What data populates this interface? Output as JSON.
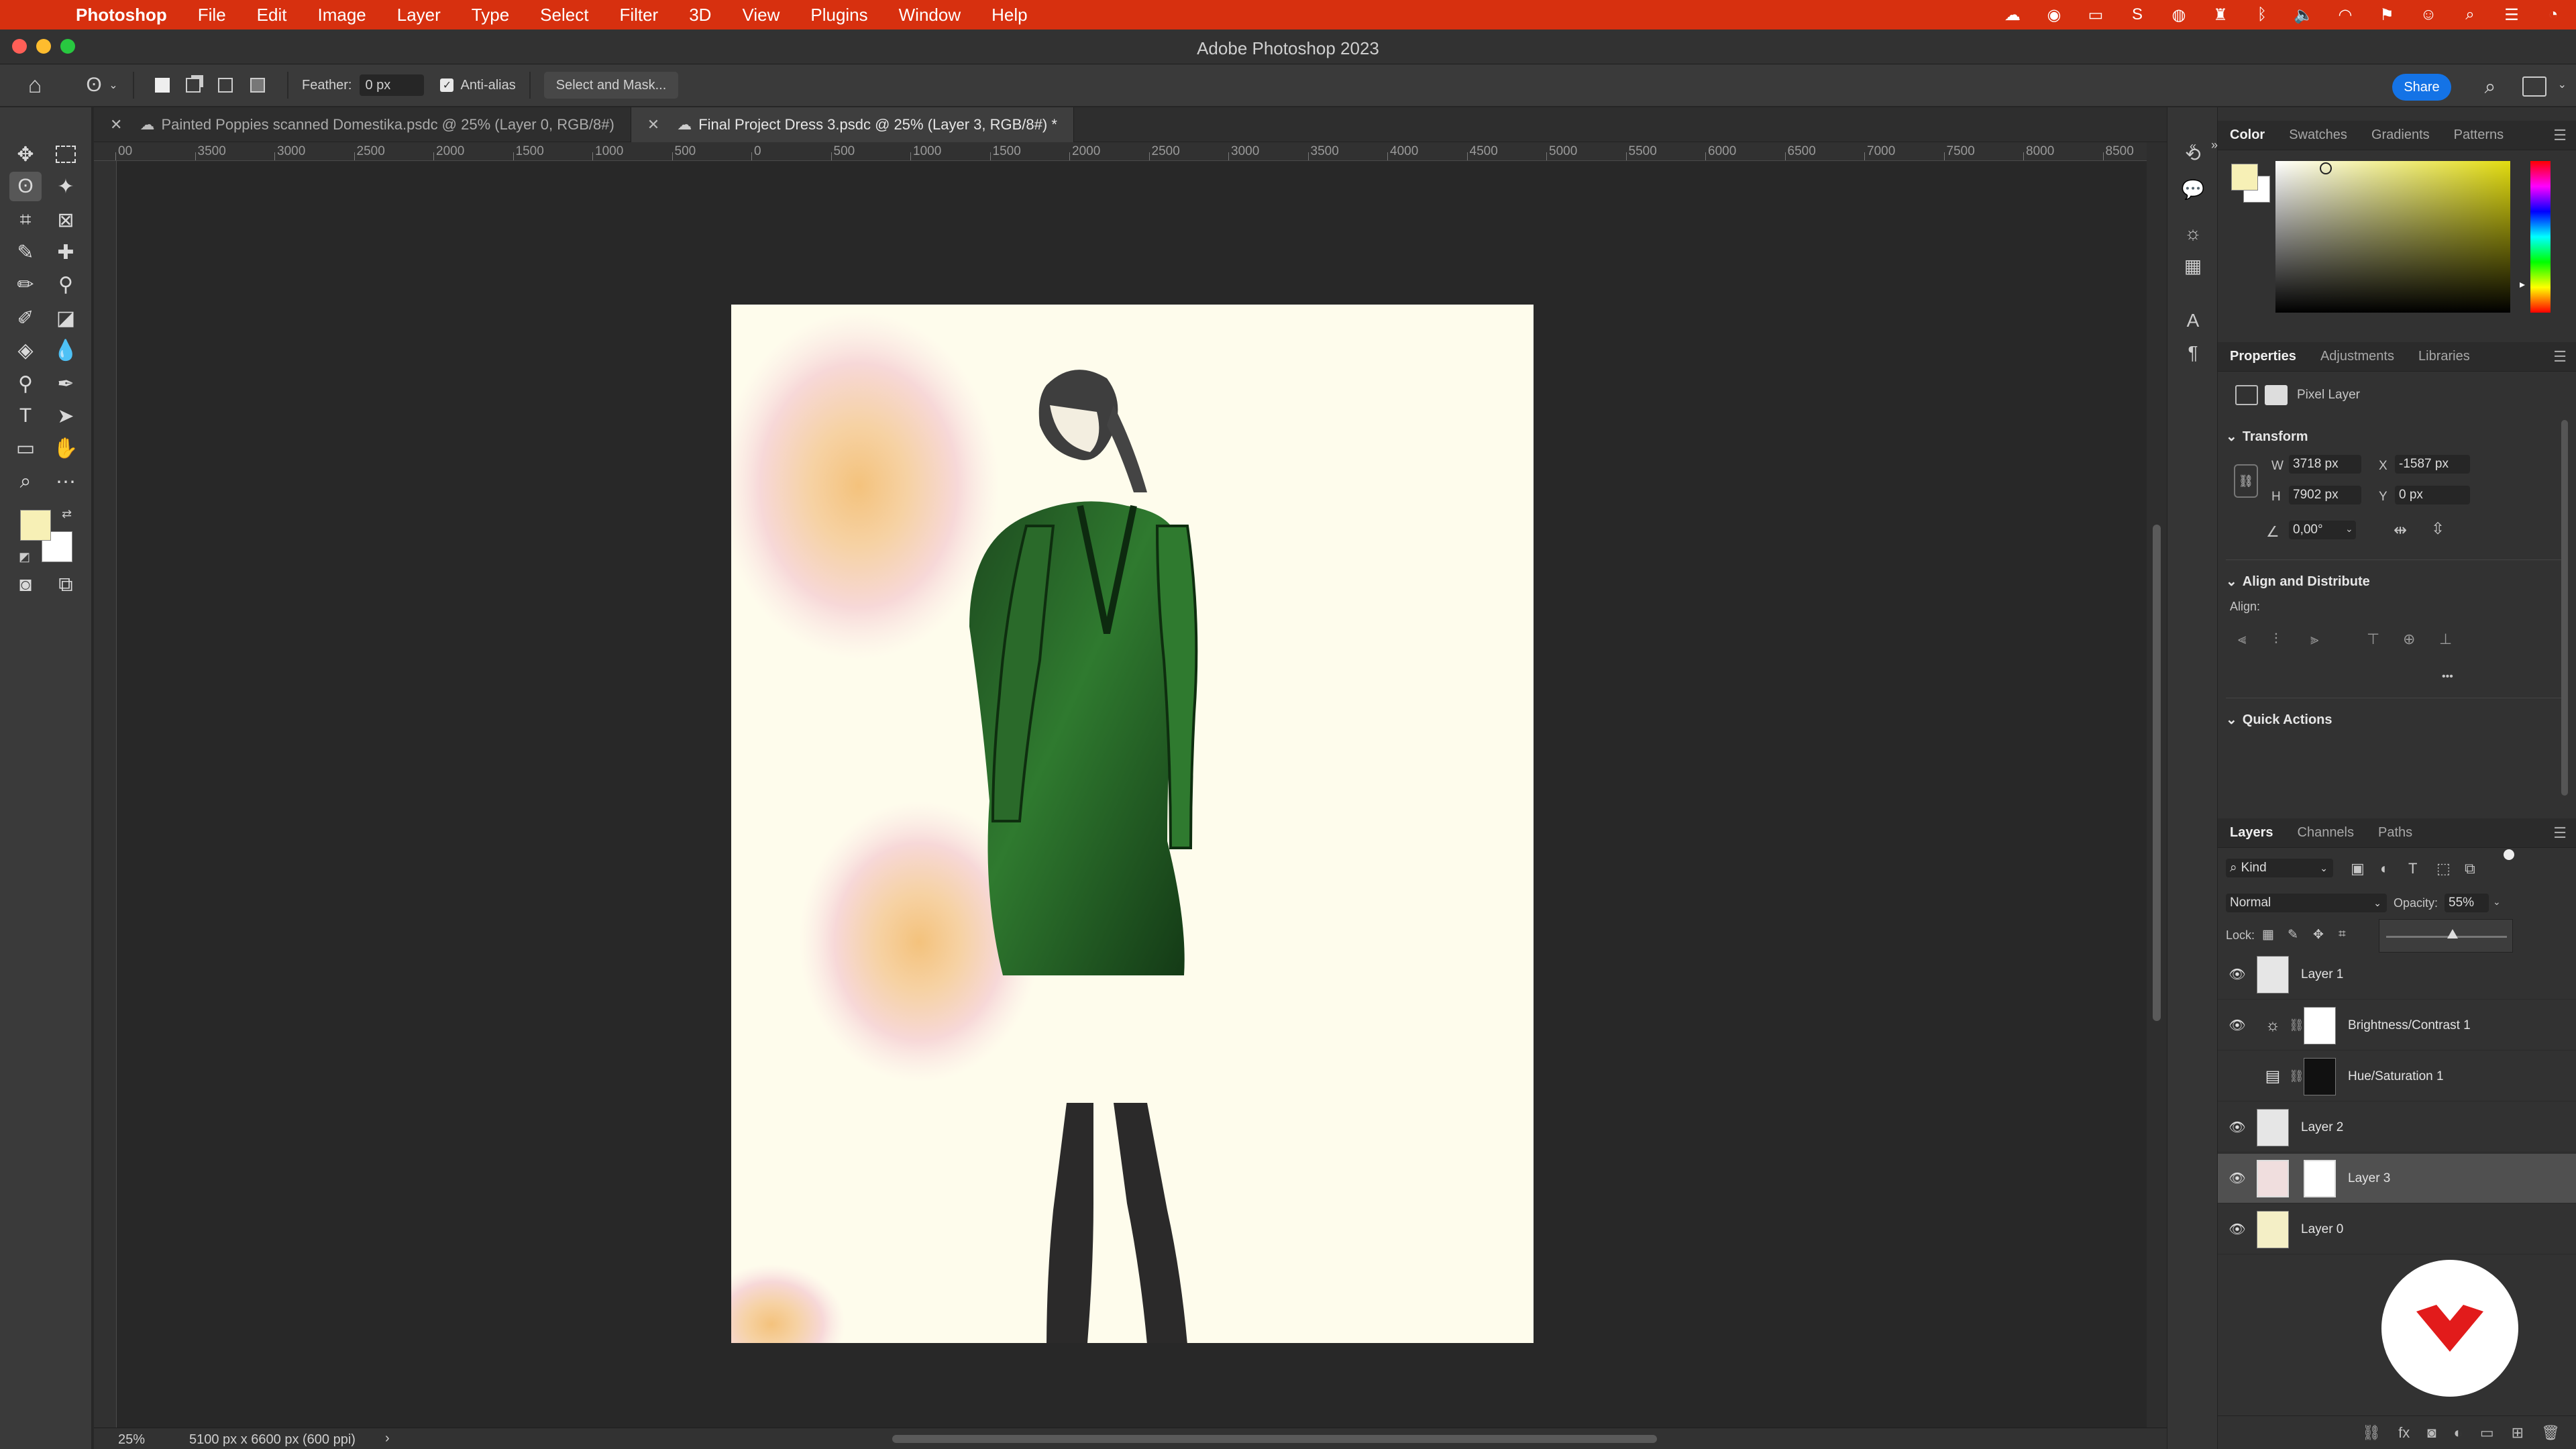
{
  "menubar": {
    "app": "Photoshop",
    "items": [
      "File",
      "Edit",
      "Image",
      "Layer",
      "Type",
      "Select",
      "Filter",
      "3D",
      "View",
      "Plugins",
      "Window",
      "Help"
    ]
  },
  "window": {
    "title": "Adobe Photoshop 2023"
  },
  "options": {
    "feather_label": "Feather:",
    "feather_value": "0 px",
    "antialias_label": "Anti-alias",
    "select_mask_label": "Select and Mask...",
    "share_label": "Share"
  },
  "tabs": [
    {
      "label": "Painted Poppies scanned Domestika.psdc @ 25% (Layer 0, RGB/8#)"
    },
    {
      "label": "Final Project Dress 3.psdc @ 25% (Layer 3, RGB/8#) *"
    }
  ],
  "ruler": {
    "h_labels": [
      "00",
      "3500",
      "3000",
      "2500",
      "2000",
      "1500",
      "1000",
      "500",
      "0",
      "500",
      "1000",
      "1500",
      "2000",
      "2500",
      "3000",
      "3500",
      "4000",
      "4500",
      "5000",
      "5500",
      "6000",
      "6500",
      "7000",
      "7500",
      "8000",
      "8500"
    ]
  },
  "status": {
    "zoom": "25%",
    "doc_size": "5100 px x 6600 px (600 ppi)",
    "arrow": "›"
  },
  "color_panel": {
    "tabs": [
      "Color",
      "Swatches",
      "Gradients",
      "Patterns"
    ],
    "fg_color": "#f7f0b6",
    "bg_color": "#ffffff"
  },
  "properties": {
    "tabs": [
      "Properties",
      "Adjustments",
      "Libraries"
    ],
    "layer_type": "Pixel Layer",
    "transform_label": "Transform",
    "w_label": "W",
    "w_value": "3718 px",
    "h_label": "H",
    "h_value": "7902 px",
    "x_label": "X",
    "x_value": "-1587 px",
    "y_label": "Y",
    "y_value": "0 px",
    "angle_value": "0,00°",
    "align_label": "Align and Distribute",
    "align_sub": "Align:",
    "quick_actions": "Quick Actions",
    "more": "•••"
  },
  "layers_panel": {
    "tabs": [
      "Layers",
      "Channels",
      "Paths"
    ],
    "kind_label": "Kind",
    "blend_mode": "Normal",
    "opacity_label": "Opacity:",
    "opacity_value": "55%",
    "opacity_fraction": 0.55,
    "lock_label": "Lock:",
    "layers": [
      {
        "name": "Layer 1",
        "visible": true,
        "selected": false
      },
      {
        "name": "Brightness/Contrast 1",
        "visible": true,
        "selected": false
      },
      {
        "name": "Hue/Saturation 1",
        "visible": false,
        "selected": false
      },
      {
        "name": "Layer 2",
        "visible": true,
        "selected": false
      },
      {
        "name": "Layer 3",
        "visible": true,
        "selected": true
      },
      {
        "name": "Layer 0",
        "visible": true,
        "selected": false
      }
    ]
  },
  "icons": {
    "apple": "",
    "home": "⌂",
    "eye": "👁",
    "chain": "⛓",
    "search": "⌕"
  },
  "colors": {
    "menubar": "#d7300f",
    "share_button": "#1473e6",
    "badge": "#e21b1b"
  }
}
